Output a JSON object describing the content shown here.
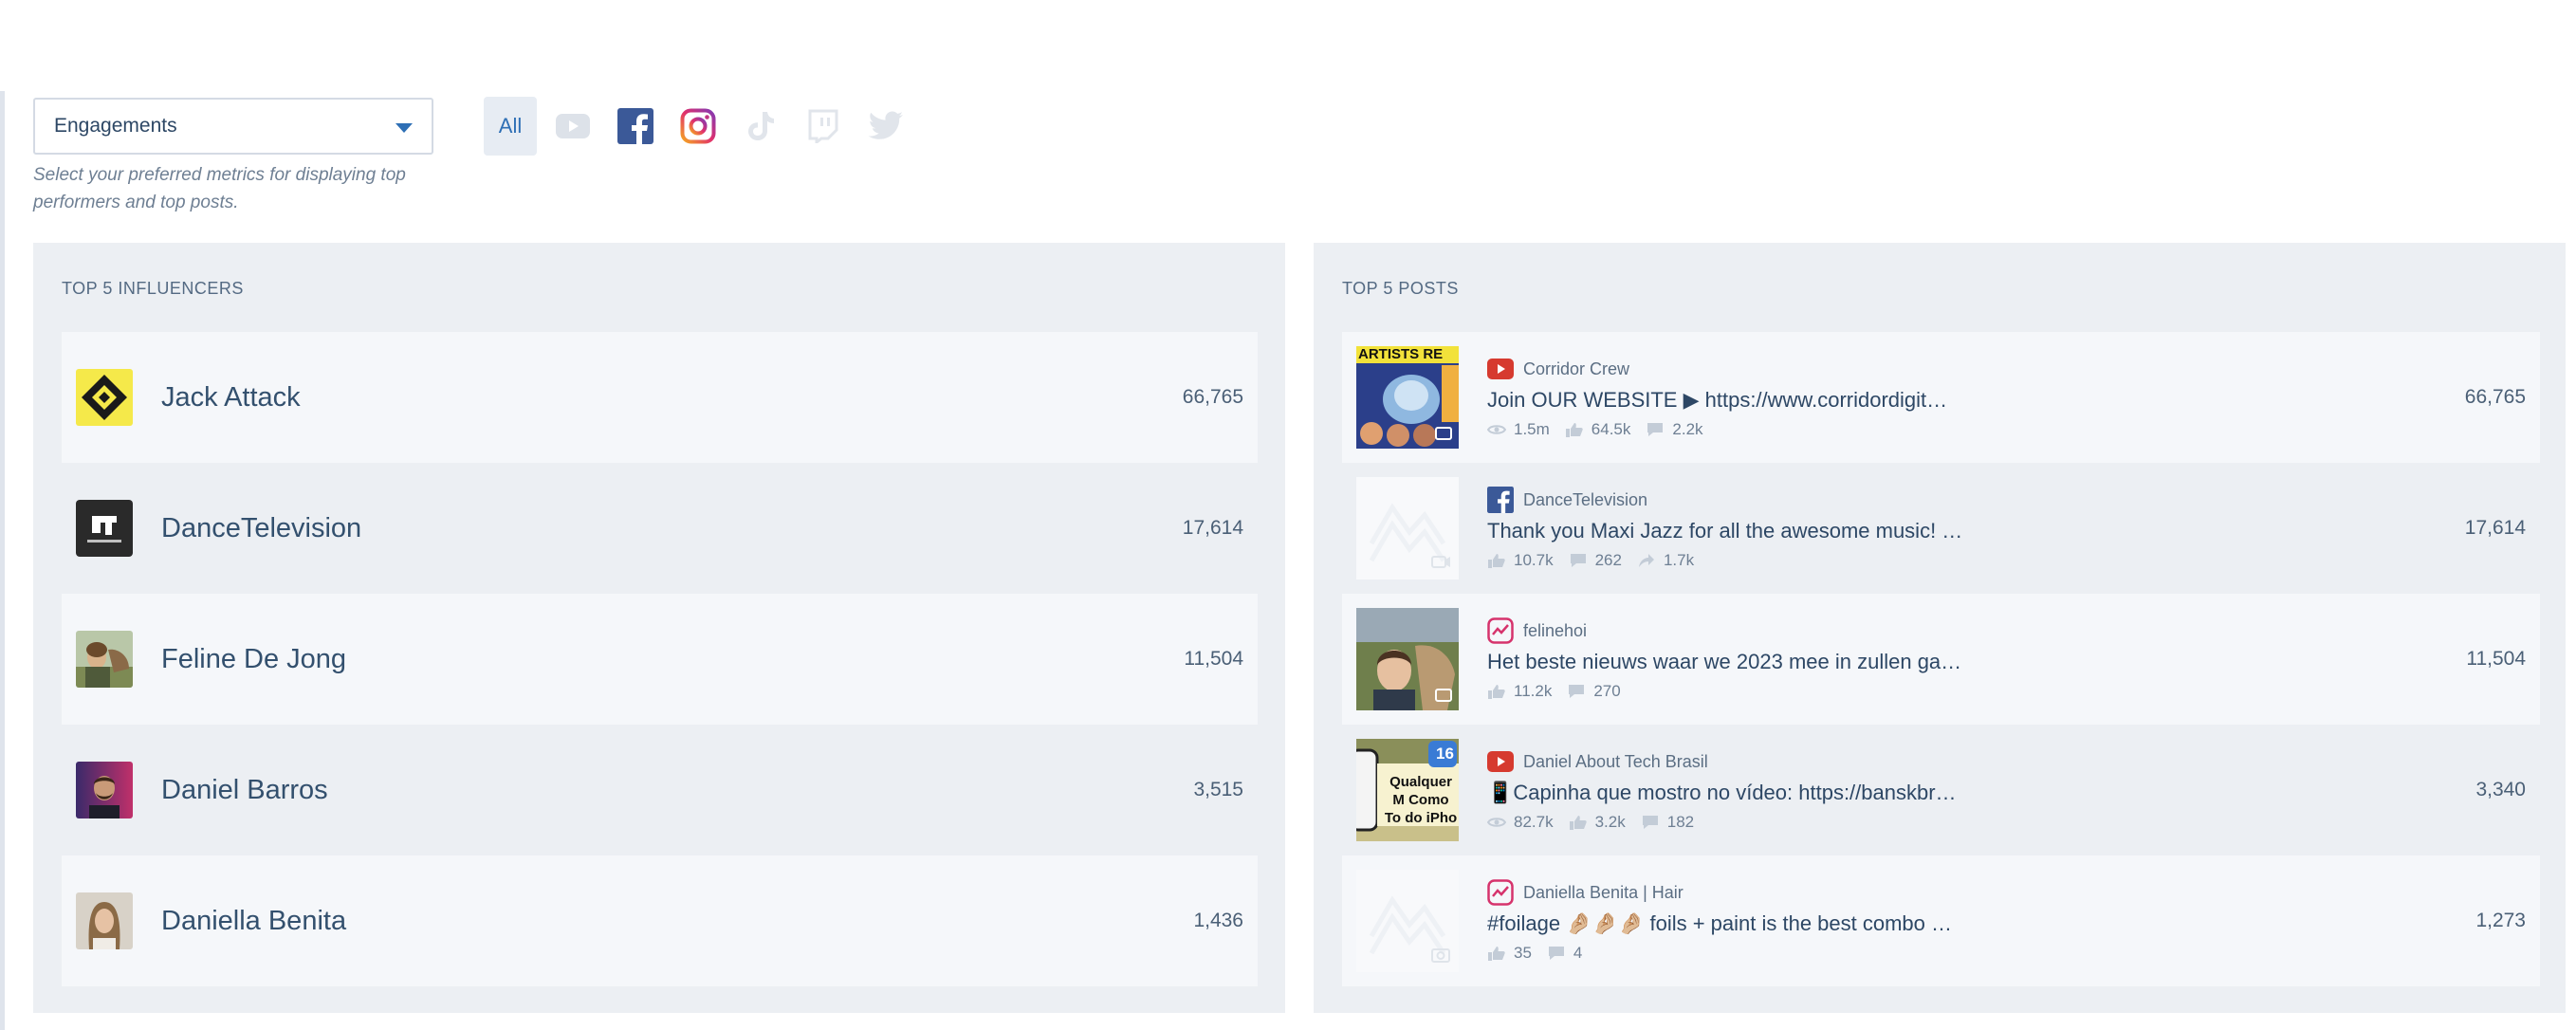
{
  "colors": {
    "accent": "#2e6fb5",
    "panel": "#eceff3",
    "row_light": "#f5f7fa",
    "youtube": "#d63a2f",
    "facebook": "#3b5998",
    "instagram": "#d6336c"
  },
  "metric": {
    "selected": "Engagements",
    "hint": "Select your preferred metrics for displaying top performers and top posts."
  },
  "platforms": [
    {
      "label": "All",
      "icon": "all"
    },
    {
      "icon": "youtube-icon"
    },
    {
      "icon": "facebook-icon"
    },
    {
      "icon": "instagram-icon"
    },
    {
      "icon": "tiktok-icon"
    },
    {
      "icon": "twitch-icon"
    },
    {
      "icon": "twitter-icon"
    }
  ],
  "influencers": {
    "title": "TOP 5 INFLUENCERS",
    "items": [
      {
        "name": "Jack Attack",
        "value": "66,765"
      },
      {
        "name": "DanceTelevision",
        "value": "17,614"
      },
      {
        "name": "Feline De Jong",
        "value": "11,504"
      },
      {
        "name": "Daniel Barros",
        "value": "3,515"
      },
      {
        "name": "Daniella Benita",
        "value": "1,436"
      }
    ]
  },
  "posts": {
    "title": "TOP 5 POSTS",
    "items": [
      {
        "platform": "youtube",
        "source": "Corridor Crew",
        "title": "Join OUR WEBSITE ▶ https://www.corridordigit…",
        "value": "66,765",
        "thumb_text": "ARTISTS RE",
        "stats": [
          {
            "icon": "views-icon",
            "value": "1.5m"
          },
          {
            "icon": "likes-icon",
            "value": "64.5k"
          },
          {
            "icon": "comments-icon",
            "value": "2.2k"
          }
        ]
      },
      {
        "platform": "facebook",
        "source": "DanceTelevision",
        "title": "Thank you Maxi Jazz for all the awesome music! …",
        "value": "17,614",
        "stats": [
          {
            "icon": "likes-icon",
            "value": "10.7k"
          },
          {
            "icon": "comments-icon",
            "value": "262"
          },
          {
            "icon": "shares-icon",
            "value": "1.7k"
          }
        ]
      },
      {
        "platform": "instagram",
        "source": "felinehoi",
        "title": "Het beste nieuws waar we 2023 mee in zullen ga…",
        "value": "11,504",
        "stats": [
          {
            "icon": "likes-icon",
            "value": "11.2k"
          },
          {
            "icon": "comments-icon",
            "value": "270"
          }
        ]
      },
      {
        "platform": "youtube",
        "source": "Daniel About Tech Brasil",
        "title": "📱Capinha que mostro no vídeo: https://banskbr…",
        "value": "3,340",
        "thumb_text": "Qualquer M Como To do iPho",
        "thumb_badge": "16",
        "stats": [
          {
            "icon": "views-icon",
            "value": "82.7k"
          },
          {
            "icon": "likes-icon",
            "value": "3.2k"
          },
          {
            "icon": "comments-icon",
            "value": "182"
          }
        ]
      },
      {
        "platform": "instagram",
        "source": "Daniella Benita | Hair",
        "title": "#foilage 🤌🏼🤌🏼🤌🏼 foils + paint is the best combo …",
        "value": "1,273",
        "stats": [
          {
            "icon": "likes-icon",
            "value": "35"
          },
          {
            "icon": "comments-icon",
            "value": "4"
          }
        ]
      }
    ]
  }
}
